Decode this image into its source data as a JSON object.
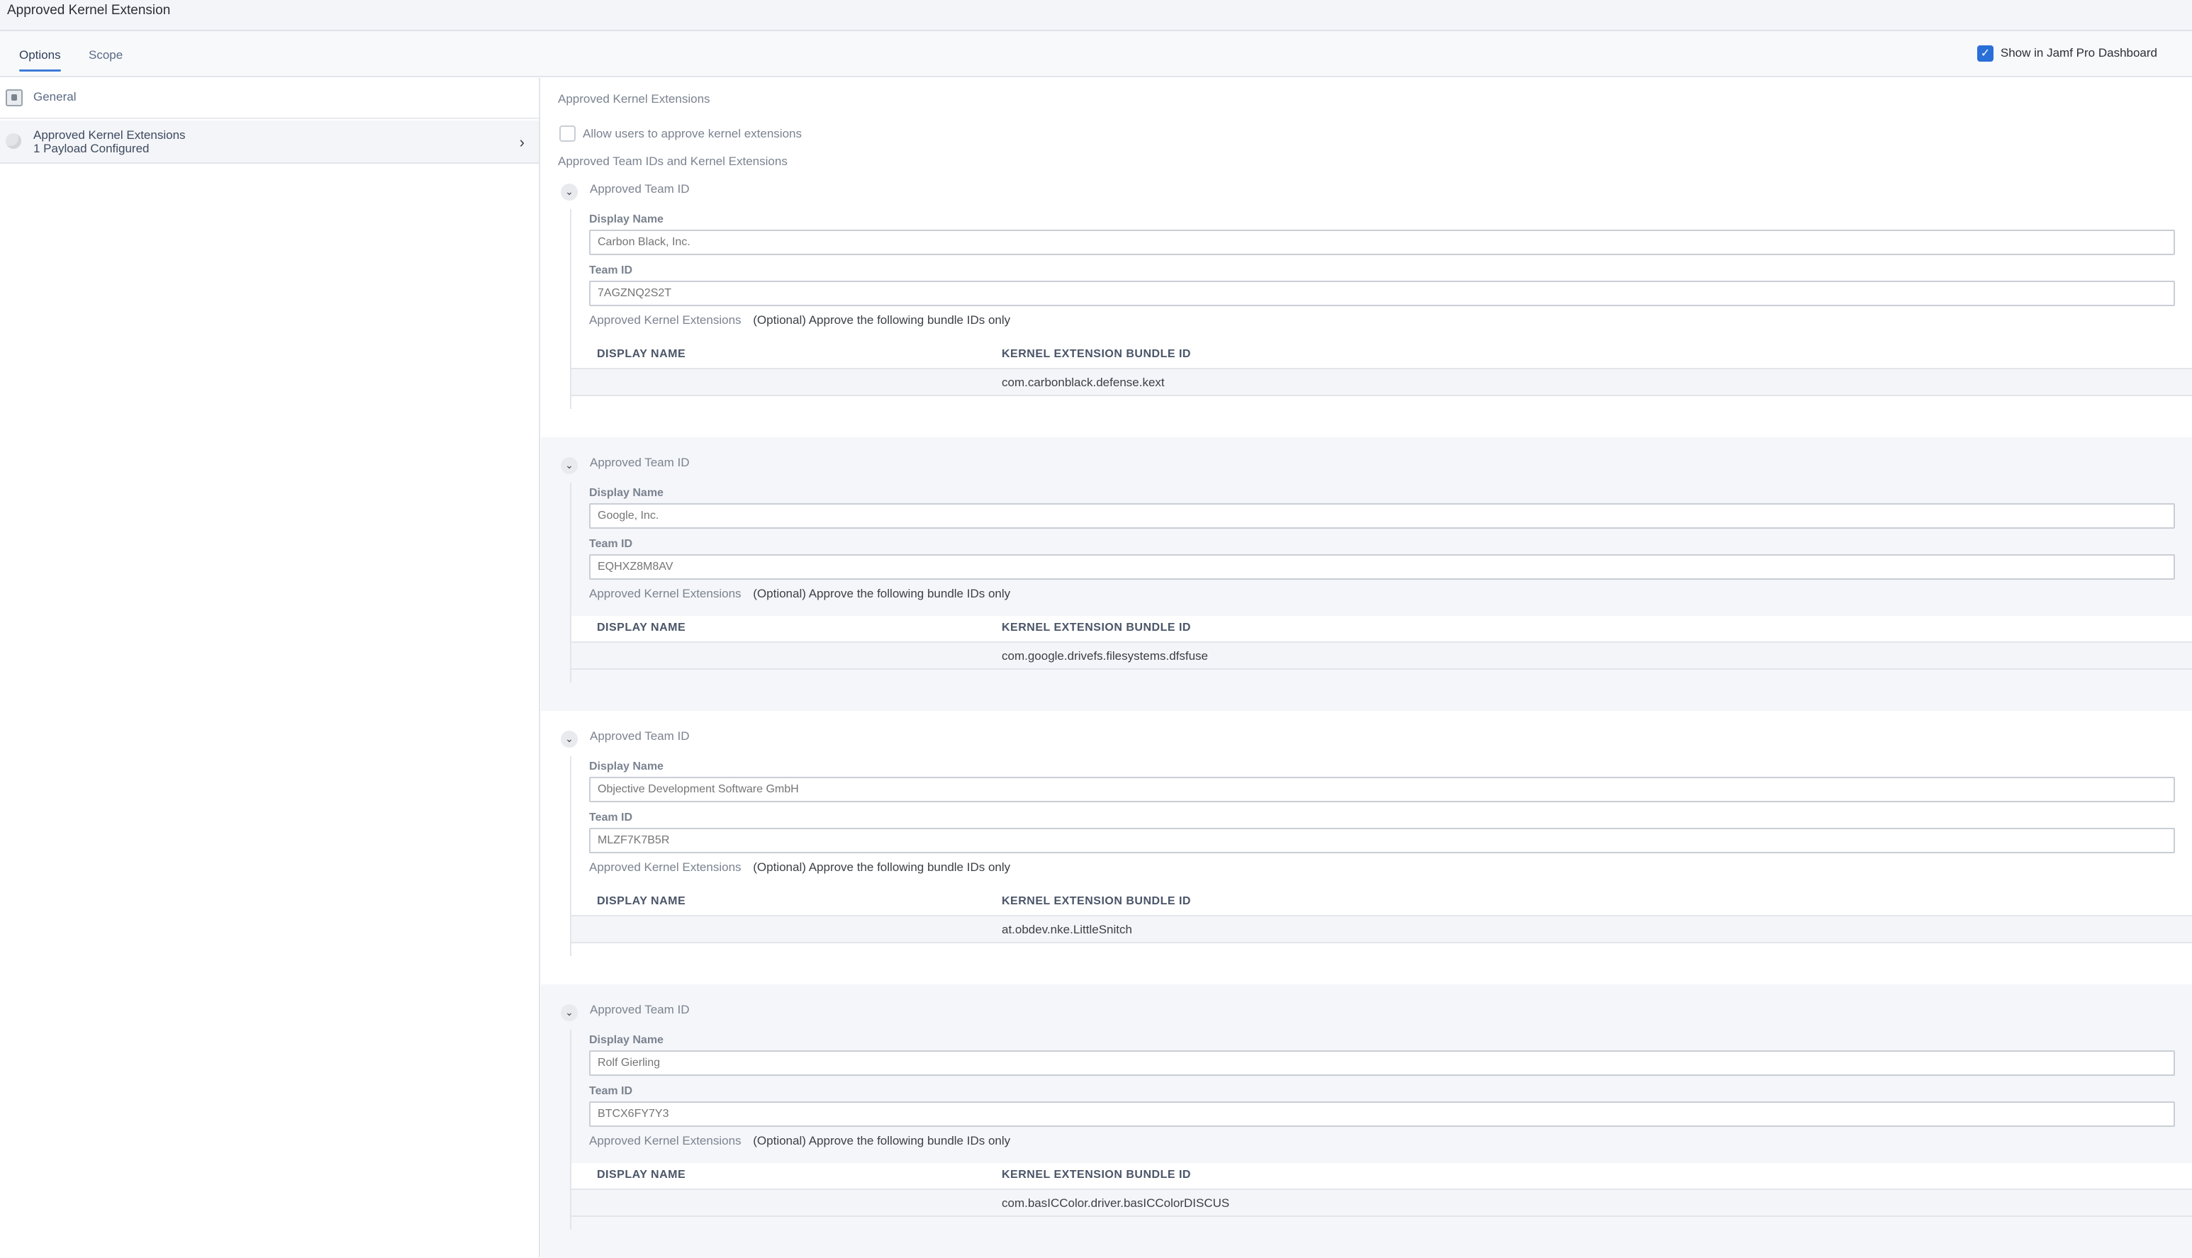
{
  "window": {
    "title": "Approved Kernel Extension"
  },
  "tabs": [
    {
      "label": "Options",
      "active": true
    },
    {
      "label": "Scope",
      "active": false
    }
  ],
  "dashboard_toggle": {
    "label": "Show in Jamf Pro Dashboard",
    "checked": true,
    "color": "#2a6fd8"
  },
  "sidebar": {
    "items": [
      {
        "label": "General",
        "icon": "general-icon"
      },
      {
        "label": "Approved Kernel Extensions",
        "sublabel": "1 Payload Configured",
        "icon": "kernel-extension-icon",
        "chevron": "›"
      }
    ]
  },
  "main": {
    "section_title": "Approved Kernel Extensions",
    "allow_users_label": "Allow users to approve kernel extensions",
    "allow_users_checked": false,
    "teams_title": "Approved Team IDs and Kernel Extensions",
    "teams": [
      {
        "heading": "Approved Team ID",
        "display_name_label": "Display Name",
        "display_name_placeholder": "Carbon Black, Inc.",
        "team_id_label": "Team ID",
        "team_id_placeholder": "7AGZNQ2S2T",
        "ake_label": "Approved Kernel Extensions",
        "ake_note": "(Optional) Approve the following bundle IDs only",
        "columns": [
          "DISPLAY NAME",
          "KERNEL EXTENSION BUNDLE ID"
        ],
        "rows": [
          {
            "display_name": "",
            "bundle_id": "com.carbonblack.defense.kext"
          }
        ]
      },
      {
        "heading": "Approved Team ID",
        "display_name_label": "Display Name",
        "display_name_placeholder": "Google, Inc.",
        "team_id_label": "Team ID",
        "team_id_placeholder": "EQHXZ8M8AV",
        "ake_label": "Approved Kernel Extensions",
        "ake_note": "(Optional) Approve the following bundle IDs only",
        "columns": [
          "DISPLAY NAME",
          "KERNEL EXTENSION BUNDLE ID"
        ],
        "rows": [
          {
            "display_name": "",
            "bundle_id": "com.google.drivefs.filesystems.dfsfuse"
          }
        ]
      },
      {
        "heading": "Approved Team ID",
        "display_name_label": "Display Name",
        "display_name_placeholder": "Objective Development Software GmbH",
        "team_id_label": "Team ID",
        "team_id_placeholder": "MLZF7K7B5R",
        "ake_label": "Approved Kernel Extensions",
        "ake_note": "(Optional) Approve the following bundle IDs only",
        "columns": [
          "DISPLAY NAME",
          "KERNEL EXTENSION BUNDLE ID"
        ],
        "rows": [
          {
            "display_name": "",
            "bundle_id": "at.obdev.nke.LittleSnitch"
          }
        ]
      },
      {
        "heading": "Approved Team ID",
        "display_name_label": "Display Name",
        "display_name_placeholder": "Rolf Gierling",
        "team_id_label": "Team ID",
        "team_id_placeholder": "BTCX6FY7Y3",
        "ake_label": "Approved Kernel Extensions",
        "ake_note": "(Optional) Approve the following bundle IDs only",
        "columns": [
          "DISPLAY NAME",
          "KERNEL EXTENSION BUNDLE ID"
        ],
        "rows": [
          {
            "display_name": "",
            "bundle_id": "com.basICColor.driver.basICColorDISCUS"
          }
        ]
      }
    ]
  }
}
